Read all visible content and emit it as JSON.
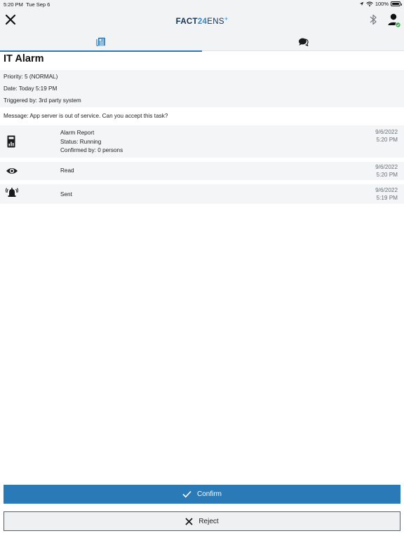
{
  "status_bar": {
    "time": "5:20 PM",
    "date": "Tue Sep 6",
    "battery": "100%",
    "icons": [
      "location-icon",
      "wifi-icon",
      "battery-icon"
    ]
  },
  "header": {
    "logo_part1": "FACT",
    "logo_part2": "24",
    "logo_part3": "ENS",
    "logo_part4": "+",
    "icons": [
      "close-icon",
      "bluetooth-icon",
      "user-icon"
    ],
    "accent_color": "#2a7ab8"
  },
  "tabs": [
    {
      "icon": "document-icon",
      "active": true
    },
    {
      "icon": "chat-bubbles-icon",
      "active": false
    }
  ],
  "alarm": {
    "title": "IT Alarm",
    "priority": "Priority: 5 (NORMAL)",
    "date": "Date: Today 5:19 PM",
    "triggered_by": "Triggered by: 3rd party system",
    "message": "Message: App server is out of service. Can you accept this task?"
  },
  "events": [
    {
      "icon": "report-icon",
      "line1": "Alarm Report",
      "line2": "Status: Running",
      "line3": "Confirmed by: 0 persons",
      "date": "9/6/2022",
      "time": "5:20 PM"
    },
    {
      "icon": "eye-icon",
      "line1": "Read",
      "date": "9/6/2022",
      "time": "5:20 PM"
    },
    {
      "icon": "alarm-bell-icon",
      "line1": "Sent",
      "date": "9/6/2022",
      "time": "5:19 PM"
    }
  ],
  "actions": {
    "confirm_label": "Confirm",
    "reject_label": "Reject"
  }
}
